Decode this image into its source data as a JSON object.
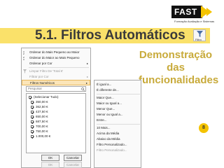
{
  "logo": {
    "text": "FAST",
    "tagline": "Formação Avaliação e Sistemas"
  },
  "title": "5.1. Filtros Automáticos",
  "filter_badge_label": "Filtro",
  "demo_text": [
    "Demonstração",
    "das",
    "funcionalidades"
  ],
  "page_number": "8",
  "menu": {
    "items": [
      {
        "label": "Ordenar do Mais Pequeno ao Maior",
        "disabled": false
      },
      {
        "label": "Ordenar do Maior ao Mais Pequeno",
        "disabled": false
      },
      {
        "label": "Ordenar por Cor",
        "disabled": false
      },
      {
        "label": "Limpar Filtro De 'Total €'",
        "disabled": true
      },
      {
        "label": "Filtrar por Cor",
        "disabled": true
      },
      {
        "label": "Filtros Numéricos",
        "disabled": false
      }
    ],
    "search_placeholder": "Pesquisar",
    "checkboxes": [
      "(Selecionar Tudo)",
      "350,00 €",
      "362,50 €",
      "437,50 €",
      "650,00 €",
      "687,50 €",
      "700,00 €",
      "750,00 €",
      "1.000,00 €"
    ],
    "ok_label": "OK",
    "cancel_label": "Cancelar",
    "ok_label_shadow": "OK",
    "cancel_label_shadow": "Cancelar"
  },
  "submenu": {
    "items": [
      "É igual a...",
      "É diferente de...",
      "Maior Que...",
      "Maior ou Igual a...",
      "Menor Que...",
      "Menor ou Igual a...",
      "Entre...",
      "10 Mais...",
      "Acima da Média",
      "Abaixo da Média",
      "Filtro Personalizado...",
      "Filtro Personalizado..."
    ]
  }
}
